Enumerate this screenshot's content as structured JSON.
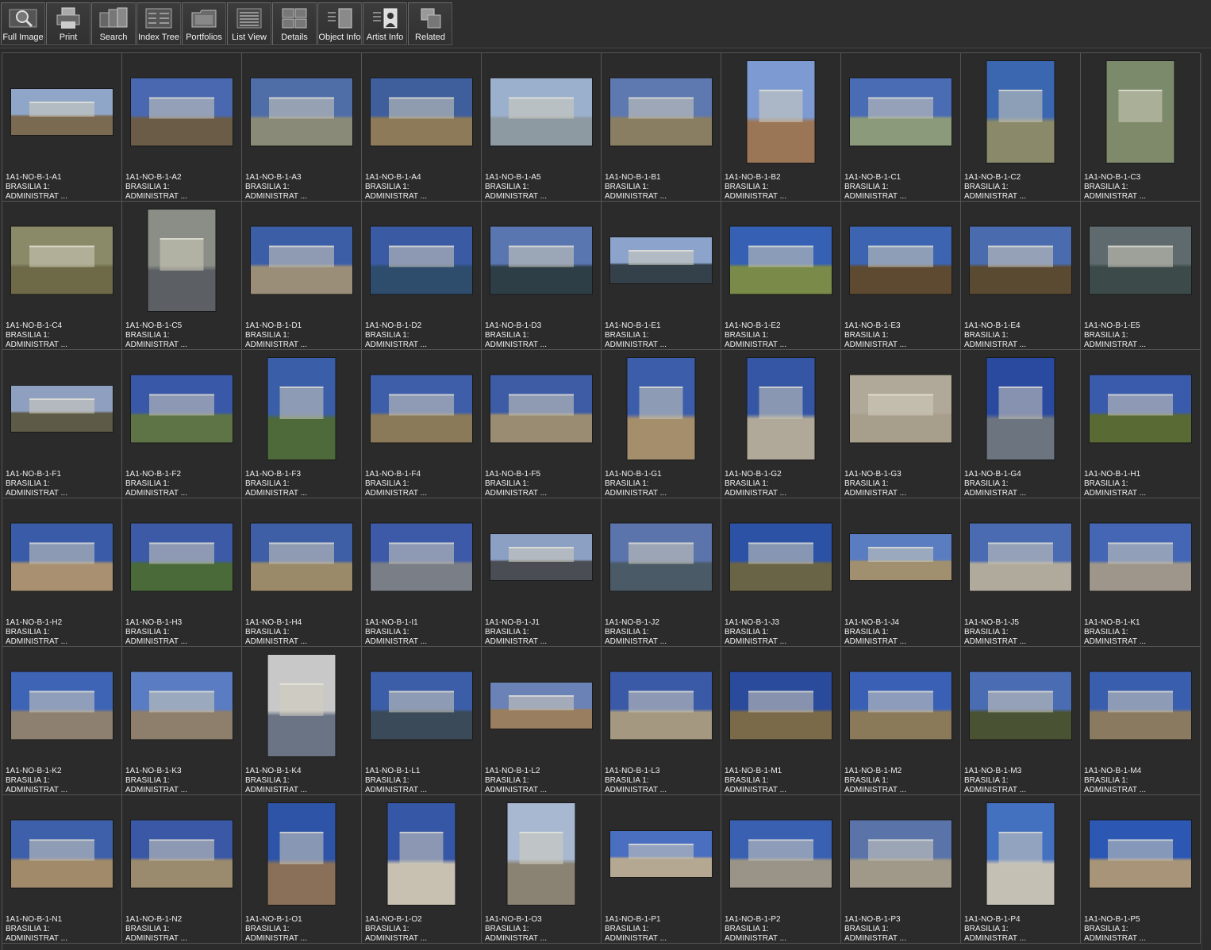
{
  "toolbar": {
    "buttons": [
      {
        "label": "Full Image",
        "icon": "magnifier-icon"
      },
      {
        "label": "Print",
        "icon": "printer-icon"
      },
      {
        "label": "Search",
        "icon": "search-stack-icon"
      },
      {
        "label": "Index Tree",
        "icon": "index-tree-icon"
      },
      {
        "label": "Portfolios",
        "icon": "portfolio-folder-icon"
      },
      {
        "label": "List View",
        "icon": "list-view-icon"
      },
      {
        "label": "Details",
        "icon": "details-grid-icon"
      },
      {
        "label": "Object Info",
        "icon": "object-info-icon"
      },
      {
        "label": "Artist  Info",
        "icon": "artist-portrait-icon"
      },
      {
        "label": "Related",
        "icon": "related-stack-icon"
      }
    ]
  },
  "grid": {
    "caption_line2": "BRASILIA 1:",
    "caption_line3": "ADMINISTRAT ...",
    "items": [
      {
        "id": "1A1-NO-B-1-A1",
        "shape": "wide",
        "sky": "#8fa6c8",
        "ground": "#7a6a52"
      },
      {
        "id": "1A1-NO-B-1-A2",
        "shape": "land",
        "sky": "#4a68b0",
        "ground": "#6b5c48"
      },
      {
        "id": "1A1-NO-B-1-A3",
        "shape": "land",
        "sky": "#4f6ea8",
        "ground": "#8a8a78"
      },
      {
        "id": "1A1-NO-B-1-A4",
        "shape": "land",
        "sky": "#3e5e9c",
        "ground": "#8c7a58"
      },
      {
        "id": "1A1-NO-B-1-A5",
        "shape": "land",
        "sky": "#9bb0cc",
        "ground": "#8e9aa2"
      },
      {
        "id": "1A1-NO-B-1-B1",
        "shape": "land",
        "sky": "#5e78b0",
        "ground": "#8a7e62"
      },
      {
        "id": "1A1-NO-B-1-B2",
        "shape": "port",
        "sky": "#7d9ad2",
        "ground": "#9a7656"
      },
      {
        "id": "1A1-NO-B-1-C1",
        "shape": "land",
        "sky": "#4a6cb4",
        "ground": "#8a9a7a"
      },
      {
        "id": "1A1-NO-B-1-C2",
        "shape": "port",
        "sky": "#3b66b0",
        "ground": "#8a8a6a"
      },
      {
        "id": "1A1-NO-B-1-C3",
        "shape": "port",
        "sky": "#7a8a6a",
        "ground": "#7e8a6a"
      },
      {
        "id": "1A1-NO-B-1-C4",
        "shape": "land",
        "sky": "#8a8a68",
        "ground": "#6e6a48"
      },
      {
        "id": "1A1-NO-B-1-C5",
        "shape": "port",
        "sky": "#8a8e86",
        "ground": "#5c6064"
      },
      {
        "id": "1A1-NO-B-1-D1",
        "shape": "land",
        "sky": "#3c5ea6",
        "ground": "#9a8e78"
      },
      {
        "id": "1A1-NO-B-1-D2",
        "shape": "land",
        "sky": "#3a5aa4",
        "ground": "#2e4c6c"
      },
      {
        "id": "1A1-NO-B-1-D3",
        "shape": "land",
        "sky": "#5a76b0",
        "ground": "#2e3e46"
      },
      {
        "id": "1A1-NO-B-1-E1",
        "shape": "wide",
        "sky": "#8ca4cc",
        "ground": "#34404a"
      },
      {
        "id": "1A1-NO-B-1-E2",
        "shape": "land",
        "sky": "#3560b4",
        "ground": "#7a8a48"
      },
      {
        "id": "1A1-NO-B-1-E3",
        "shape": "land",
        "sky": "#3c64b0",
        "ground": "#5e4a30"
      },
      {
        "id": "1A1-NO-B-1-E4",
        "shape": "land",
        "sky": "#4a6cae",
        "ground": "#5a4a32"
      },
      {
        "id": "1A1-NO-B-1-E5",
        "shape": "land",
        "sky": "#5e6a6e",
        "ground": "#3c4a4a"
      },
      {
        "id": "1A1-NO-B-1-F1",
        "shape": "wide",
        "sky": "#8e9fbf",
        "ground": "#5e5a48"
      },
      {
        "id": "1A1-NO-B-1-F2",
        "shape": "land",
        "sky": "#3a58a8",
        "ground": "#5e7446"
      },
      {
        "id": "1A1-NO-B-1-F3",
        "shape": "port",
        "sky": "#3b5ea8",
        "ground": "#4e6a3a"
      },
      {
        "id": "1A1-NO-B-1-F4",
        "shape": "land",
        "sky": "#3e5eaa",
        "ground": "#8a7a5a"
      },
      {
        "id": "1A1-NO-B-1-F5",
        "shape": "land",
        "sky": "#3e5ca6",
        "ground": "#9a8c72"
      },
      {
        "id": "1A1-NO-B-1-G1",
        "shape": "port",
        "sky": "#3c5eaa",
        "ground": "#a48e6c"
      },
      {
        "id": "1A1-NO-B-1-G2",
        "shape": "port",
        "sky": "#3456a4",
        "ground": "#b0a898"
      },
      {
        "id": "1A1-NO-B-1-G3",
        "shape": "land",
        "sky": "#b0a898",
        "ground": "#a89e8c"
      },
      {
        "id": "1A1-NO-B-1-G4",
        "shape": "port",
        "sky": "#2a4aa0",
        "ground": "#6c7480"
      },
      {
        "id": "1A1-NO-B-1-H1",
        "shape": "land",
        "sky": "#3a5aac",
        "ground": "#5a6a34"
      },
      {
        "id": "1A1-NO-B-1-H2",
        "shape": "land",
        "sky": "#3a5ca8",
        "ground": "#a89070"
      },
      {
        "id": "1A1-NO-B-1-H3",
        "shape": "land",
        "sky": "#3c5aa6",
        "ground": "#4a6a3a"
      },
      {
        "id": "1A1-NO-B-1-H4",
        "shape": "land",
        "sky": "#3e5ea6",
        "ground": "#9a8a6a"
      },
      {
        "id": "1A1-NO-B-1-I1",
        "shape": "land",
        "sky": "#3c5aa8",
        "ground": "#7a7e86"
      },
      {
        "id": "1A1-NO-B-1-J1",
        "shape": "wide",
        "sky": "#8ca0c4",
        "ground": "#4a4e54"
      },
      {
        "id": "1A1-NO-B-1-J2",
        "shape": "land",
        "sky": "#5c74ac",
        "ground": "#4a5a66"
      },
      {
        "id": "1A1-NO-B-1-J3",
        "shape": "land",
        "sky": "#2c52a6",
        "ground": "#6a6446"
      },
      {
        "id": "1A1-NO-B-1-J4",
        "shape": "wide",
        "sky": "#5a7cc0",
        "ground": "#a09070"
      },
      {
        "id": "1A1-NO-B-1-J5",
        "shape": "land",
        "sky": "#4a6ab2",
        "ground": "#b0aa9c"
      },
      {
        "id": "1A1-NO-B-1-K1",
        "shape": "land",
        "sky": "#4466b4",
        "ground": "#9e968a"
      },
      {
        "id": "1A1-NO-B-1-K2",
        "shape": "land",
        "sky": "#3e64b6",
        "ground": "#8e8070"
      },
      {
        "id": "1A1-NO-B-1-K3",
        "shape": "land",
        "sky": "#5a7cc2",
        "ground": "#8e7e6c"
      },
      {
        "id": "1A1-NO-B-1-K4",
        "shape": "port",
        "sky": "#c8c8c8",
        "ground": "#6a7484"
      },
      {
        "id": "1A1-NO-B-1-L1",
        "shape": "land",
        "sky": "#3c5ea8",
        "ground": "#3a4a58"
      },
      {
        "id": "1A1-NO-B-1-L2",
        "shape": "wide",
        "sky": "#6a82b6",
        "ground": "#9a7e60"
      },
      {
        "id": "1A1-NO-B-1-L3",
        "shape": "land",
        "sky": "#3a5aa8",
        "ground": "#a49880"
      },
      {
        "id": "1A1-NO-B-1-M1",
        "shape": "land",
        "sky": "#2a4a9c",
        "ground": "#7a6a4a"
      },
      {
        "id": "1A1-NO-B-1-M2",
        "shape": "land",
        "sky": "#3a60b6",
        "ground": "#8a7a5a"
      },
      {
        "id": "1A1-NO-B-1-M3",
        "shape": "land",
        "sky": "#4a6cb2",
        "ground": "#4a5234"
      },
      {
        "id": "1A1-NO-B-1-M4",
        "shape": "land",
        "sky": "#3a5eae",
        "ground": "#8a7a60"
      },
      {
        "id": "1A1-NO-B-1-N1",
        "shape": "land",
        "sky": "#3e60aa",
        "ground": "#a08a6a"
      },
      {
        "id": "1A1-NO-B-1-N2",
        "shape": "land",
        "sky": "#3a58a6",
        "ground": "#9a8a6e"
      },
      {
        "id": "1A1-NO-B-1-O1",
        "shape": "port",
        "sky": "#2e54a8",
        "ground": "#8a7058"
      },
      {
        "id": "1A1-NO-B-1-O2",
        "shape": "port",
        "sky": "#3656a6",
        "ground": "#c8c0b0"
      },
      {
        "id": "1A1-NO-B-1-O3",
        "shape": "port",
        "sky": "#a8b8d0",
        "ground": "#8a8272"
      },
      {
        "id": "1A1-NO-B-1-P1",
        "shape": "wide",
        "sky": "#4a6ec0",
        "ground": "#b4a892"
      },
      {
        "id": "1A1-NO-B-1-P2",
        "shape": "land",
        "sky": "#3a60b2",
        "ground": "#9a9488"
      },
      {
        "id": "1A1-NO-B-1-P3",
        "shape": "land",
        "sky": "#5a74aa",
        "ground": "#a09888"
      },
      {
        "id": "1A1-NO-B-1-P4",
        "shape": "port",
        "sky": "#4470c0",
        "ground": "#c4c0b4"
      },
      {
        "id": "1A1-NO-B-1-P5",
        "shape": "land",
        "sky": "#2c58b4",
        "ground": "#a89478"
      }
    ]
  }
}
